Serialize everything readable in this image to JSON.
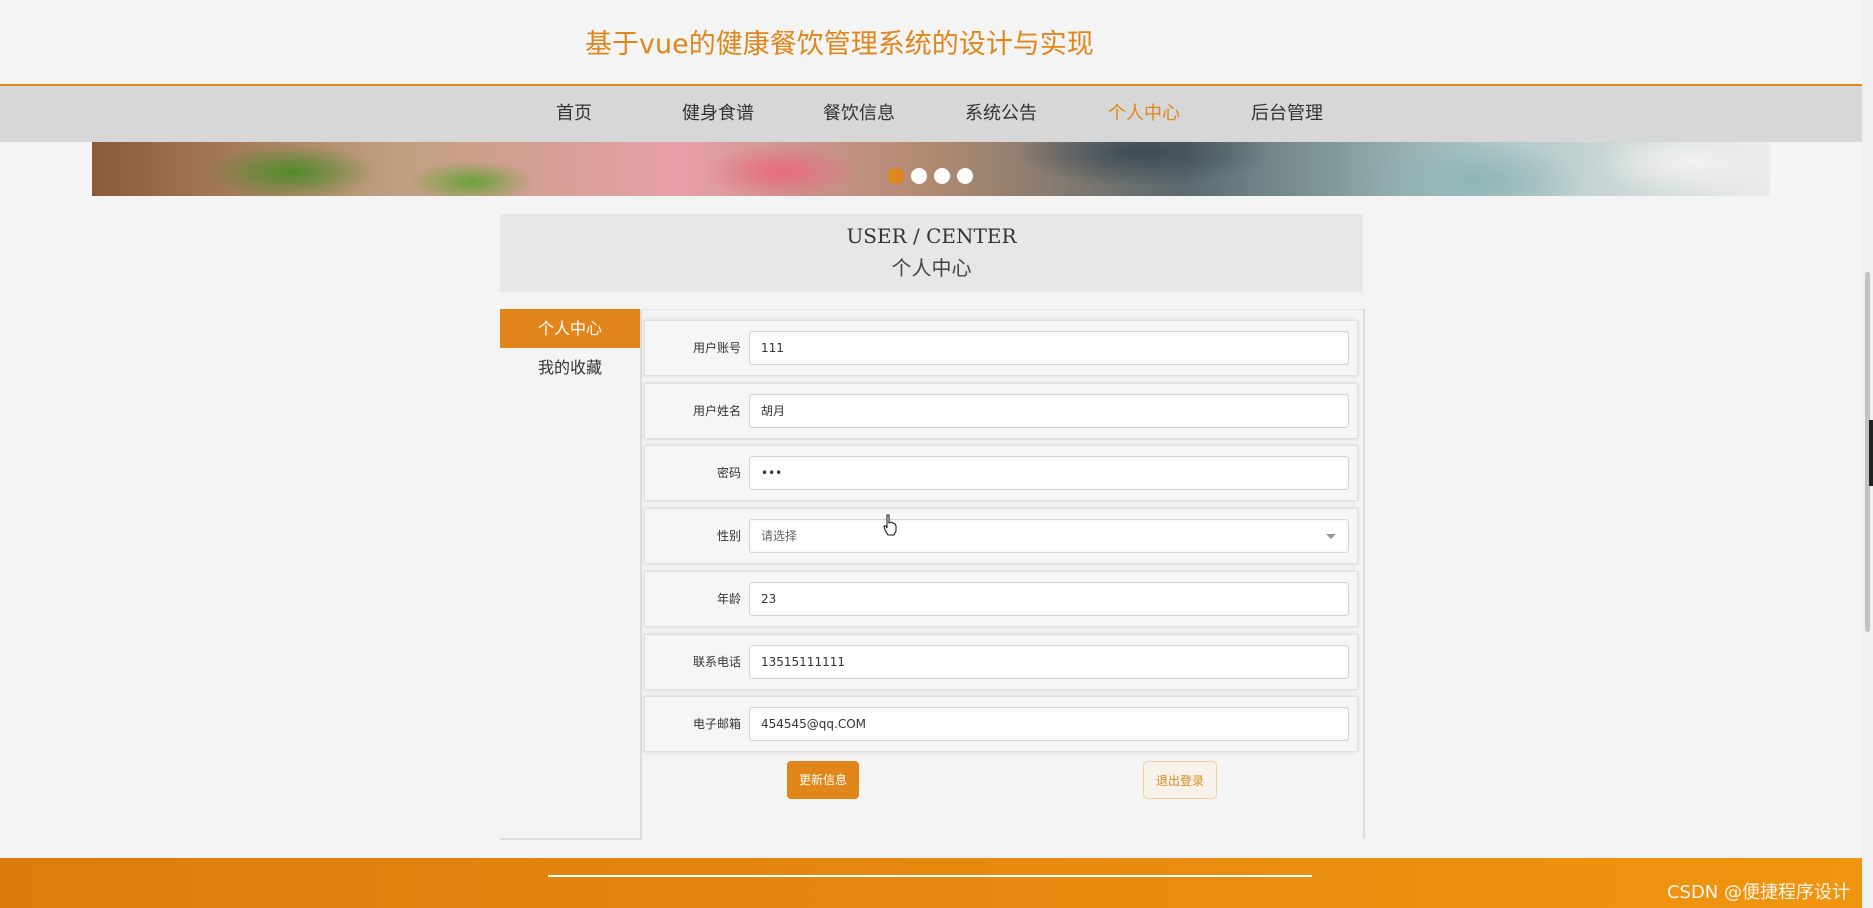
{
  "header": {
    "title": "基于vue的健康餐饮管理系统的设计与实现"
  },
  "nav": {
    "items": [
      {
        "label": "首页"
      },
      {
        "label": "健身食谱"
      },
      {
        "label": "餐饮信息"
      },
      {
        "label": "系统公告"
      },
      {
        "label": "个人中心",
        "active": true
      },
      {
        "label": "后台管理"
      }
    ]
  },
  "banner": {
    "slide_count": 4,
    "active_slide": 1
  },
  "user_center": {
    "title_en": "USER / CENTER",
    "title_cn": "个人中心"
  },
  "sidebar": {
    "items": [
      {
        "label": "个人中心",
        "active": true
      },
      {
        "label": "我的收藏"
      }
    ]
  },
  "form": {
    "fields": [
      {
        "label": "用户账号",
        "value": "111"
      },
      {
        "label": "用户姓名",
        "value": "胡月"
      },
      {
        "label": "密码",
        "value": "•••"
      },
      {
        "label": "性别",
        "placeholder": "请选择"
      },
      {
        "label": "年龄",
        "value": "23"
      },
      {
        "label": "联系电话",
        "value": "13515111111"
      },
      {
        "label": "电子邮箱",
        "value": "454545@qq.COM"
      }
    ],
    "update_button": "更新信息",
    "logout_button": "退出登录"
  },
  "footer": {
    "watermark": "CSDN @便捷程序设计"
  },
  "colors": {
    "accent": "#e0861a",
    "nav_bg": "#d7d7d7",
    "page_bg": "#f4f4f4"
  }
}
